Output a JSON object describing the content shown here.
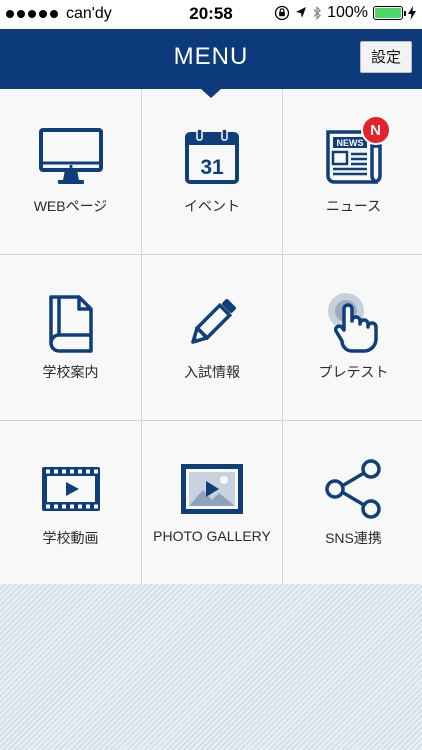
{
  "status_bar": {
    "carrier": "can'dy",
    "time": "20:58",
    "battery": "100%",
    "battery_level": 1.0,
    "icons": [
      "rotation-lock-icon",
      "location-icon",
      "bluetooth-icon",
      "charging-icon"
    ]
  },
  "header": {
    "title": "MENU",
    "settings_label": "設定"
  },
  "menu": {
    "items": [
      {
        "label": "WEBページ",
        "icon": "monitor-icon"
      },
      {
        "label": "イベント",
        "icon": "calendar-icon",
        "calendar_day": "31"
      },
      {
        "label": "ニュース",
        "icon": "newspaper-icon",
        "newspaper_text": "NEWS",
        "badge": "N"
      },
      {
        "label": "学校案内",
        "icon": "book-icon"
      },
      {
        "label": "入試情報",
        "icon": "pencil-icon"
      },
      {
        "label": "プレテスト",
        "icon": "tap-hand-icon"
      },
      {
        "label": "学校動画",
        "icon": "film-icon"
      },
      {
        "label": "PHOTO GALLERY",
        "icon": "photo-gallery-icon"
      },
      {
        "label": "SNS連携",
        "icon": "share-icon"
      }
    ]
  },
  "colors": {
    "brand": "#0c3a7a",
    "icon": "#0f3f78",
    "badge": "#e8202a",
    "battery": "#4cd964"
  }
}
